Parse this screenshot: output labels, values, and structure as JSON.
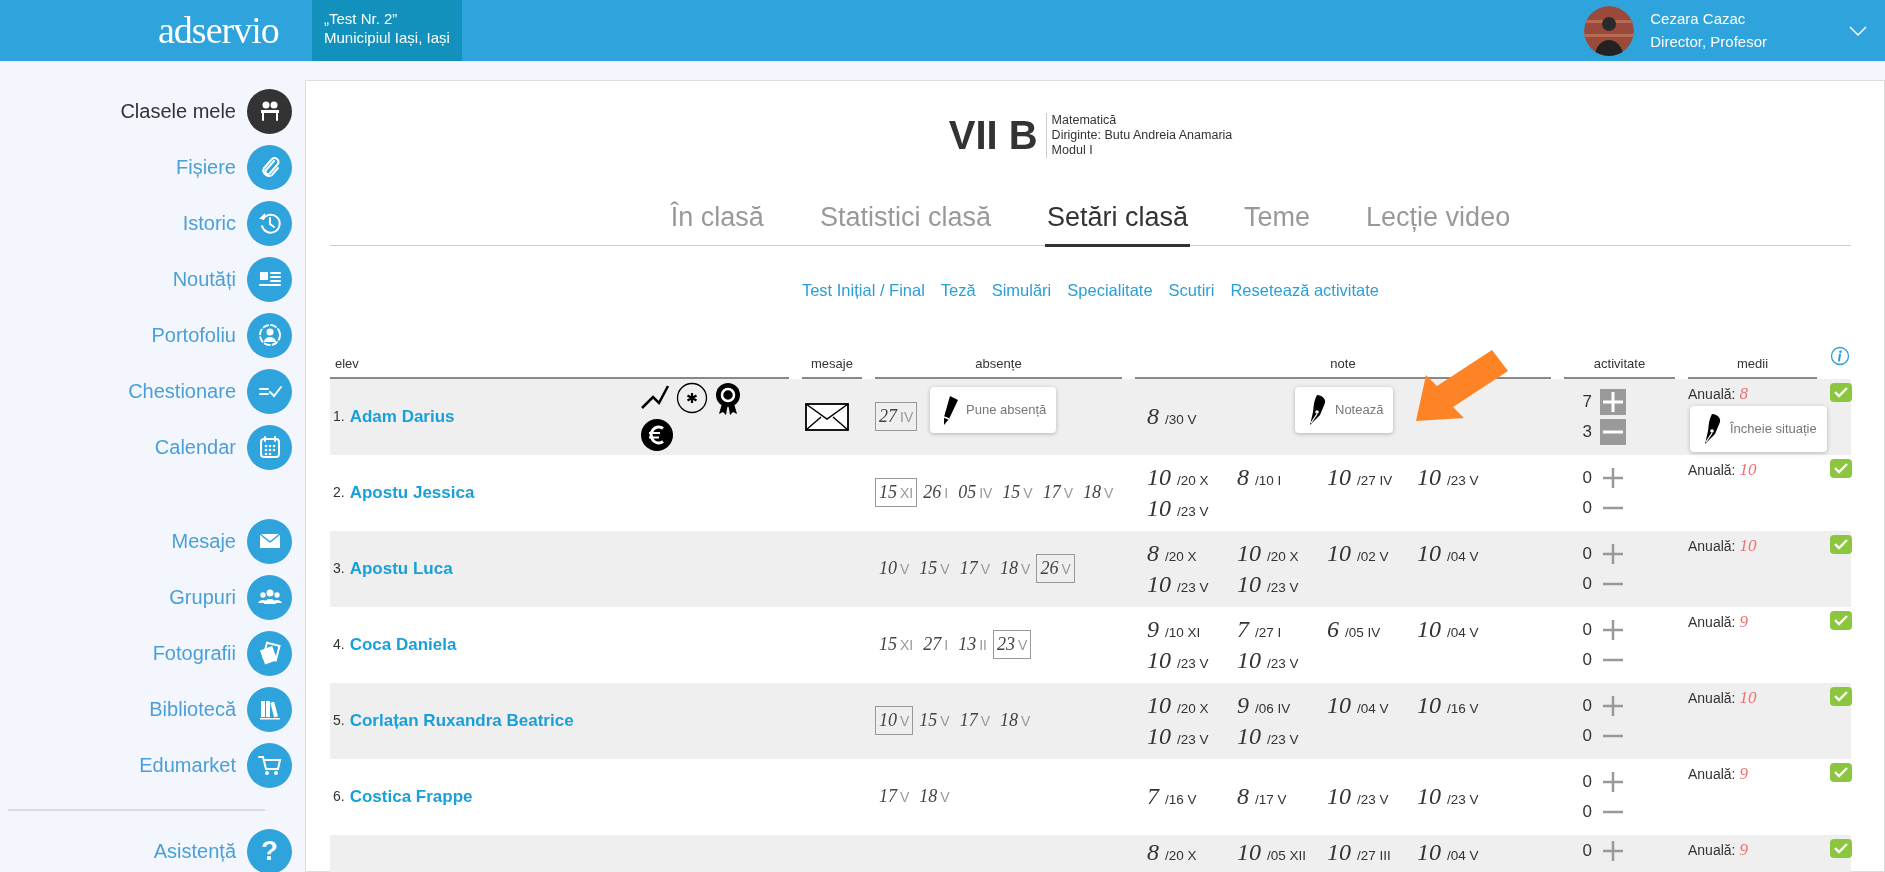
{
  "header": {
    "logo": "adservio",
    "school": {
      "name": "„Test Nr. 2”",
      "location": "Municipiul Iași, Iași"
    },
    "user": {
      "name": "Cezara Cazac",
      "role": "Director, Profesor"
    }
  },
  "sidebar": {
    "groups": [
      [
        {
          "label": "Clasele mele",
          "selected": true
        },
        {
          "label": "Fișiere",
          "selected": false
        },
        {
          "label": "Istoric",
          "selected": false
        },
        {
          "label": "Noutăți",
          "selected": false
        },
        {
          "label": "Portofoliu",
          "selected": false
        },
        {
          "label": "Chestionare",
          "selected": false
        },
        {
          "label": "Calendar",
          "selected": false
        }
      ],
      [
        {
          "label": "Mesaje",
          "selected": false
        },
        {
          "label": "Grupuri",
          "selected": false
        },
        {
          "label": "Fotografii",
          "selected": false
        },
        {
          "label": "Bibliotecă",
          "selected": false
        },
        {
          "label": "Edumarket",
          "selected": false
        }
      ]
    ],
    "help": {
      "label": "Asistență",
      "glyph": "?"
    }
  },
  "class_info": {
    "name": "VII B",
    "subject": "Matematică",
    "head_teacher": "Diriginte: Butu Andreia Anamaria",
    "module": "Modul I"
  },
  "tabs": [
    {
      "label": "În clasă",
      "selected": false
    },
    {
      "label": "Statistici clasă",
      "selected": false
    },
    {
      "label": "Setări clasă",
      "selected": true
    },
    {
      "label": "Teme",
      "selected": false
    },
    {
      "label": "Lecție video",
      "selected": false
    }
  ],
  "sub_links": [
    "Test Inițial / Final",
    "Teză",
    "Simulări",
    "Specialitate",
    "Scutiri",
    "Resetează activitate"
  ],
  "table": {
    "columns": [
      "elev",
      "mesaje",
      "absențe",
      "note",
      "activitate",
      "medii"
    ],
    "rows": [
      {
        "number": "1.",
        "name": "Adam Darius",
        "badges": true,
        "message": true,
        "absences": [
          {
            "day": "27",
            "month": "IV",
            "framed": true
          }
        ],
        "absence_action": "Pune absență",
        "grades": [
          {
            "grade": "8",
            "date": "/30 V"
          }
        ],
        "grade_action": "Notează",
        "activity": {
          "plus": "7",
          "minus": "3",
          "active": true
        },
        "average": {
          "label": "Anuală:",
          "value": "8"
        },
        "close_action": "Încheie situație"
      },
      {
        "number": "2.",
        "name": "Apostu Jessica",
        "message": false,
        "absences": [
          {
            "day": "15",
            "month": "XI",
            "framed": true
          },
          {
            "day": "26",
            "month": "I",
            "framed": false
          },
          {
            "day": "05",
            "month": "IV",
            "framed": false
          },
          {
            "day": "15",
            "month": "V",
            "framed": false
          },
          {
            "day": "17",
            "month": "V",
            "framed": false
          },
          {
            "day": "18",
            "month": "V",
            "framed": false
          }
        ],
        "grades": [
          {
            "grade": "10",
            "date": "/20 X"
          },
          {
            "grade": "8",
            "date": "/10 I"
          },
          {
            "grade": "10",
            "date": "/27 IV"
          },
          {
            "grade": "10",
            "date": "/23 V"
          },
          {
            "grade": "10",
            "date": "/23 V"
          }
        ],
        "activity": {
          "plus": "0",
          "minus": "0",
          "active": false
        },
        "average": {
          "label": "Anuală:",
          "value": "10"
        }
      },
      {
        "number": "3.",
        "name": "Apostu Luca",
        "message": false,
        "absences": [
          {
            "day": "10",
            "month": "V",
            "framed": false
          },
          {
            "day": "15",
            "month": "V",
            "framed": false
          },
          {
            "day": "17",
            "month": "V",
            "framed": false
          },
          {
            "day": "18",
            "month": "V",
            "framed": false
          },
          {
            "day": "26",
            "month": "V",
            "framed": true
          }
        ],
        "grades": [
          {
            "grade": "8",
            "date": "/20 X"
          },
          {
            "grade": "10",
            "date": "/20 X"
          },
          {
            "grade": "10",
            "date": "/02 V"
          },
          {
            "grade": "10",
            "date": "/04 V"
          },
          {
            "grade": "10",
            "date": "/23 V"
          },
          {
            "grade": "10",
            "date": "/23 V"
          }
        ],
        "activity": {
          "plus": "0",
          "minus": "0",
          "active": false
        },
        "average": {
          "label": "Anuală:",
          "value": "10"
        }
      },
      {
        "number": "4.",
        "name": "Coca Daniela",
        "message": false,
        "absences": [
          {
            "day": "15",
            "month": "XI",
            "framed": false
          },
          {
            "day": "27",
            "month": "I",
            "framed": false
          },
          {
            "day": "13",
            "month": "II",
            "framed": false
          },
          {
            "day": "23",
            "month": "V",
            "framed": true
          }
        ],
        "grades": [
          {
            "grade": "9",
            "date": "/10 XI"
          },
          {
            "grade": "7",
            "date": "/27 I"
          },
          {
            "grade": "6",
            "date": "/05 IV"
          },
          {
            "grade": "10",
            "date": "/04 V"
          },
          {
            "grade": "10",
            "date": "/23 V"
          },
          {
            "grade": "10",
            "date": "/23 V"
          }
        ],
        "activity": {
          "plus": "0",
          "minus": "0",
          "active": false
        },
        "average": {
          "label": "Anuală:",
          "value": "9"
        }
      },
      {
        "number": "5.",
        "name": "Corlațan Ruxandra Beatrice",
        "message": false,
        "absences": [
          {
            "day": "10",
            "month": "V",
            "framed": true
          },
          {
            "day": "15",
            "month": "V",
            "framed": false
          },
          {
            "day": "17",
            "month": "V",
            "framed": false
          },
          {
            "day": "18",
            "month": "V",
            "framed": false
          }
        ],
        "grades": [
          {
            "grade": "10",
            "date": "/20 X"
          },
          {
            "grade": "9",
            "date": "/06 IV"
          },
          {
            "grade": "10",
            "date": "/04 V"
          },
          {
            "grade": "10",
            "date": "/16 V"
          },
          {
            "grade": "10",
            "date": "/23 V"
          },
          {
            "grade": "10",
            "date": "/23 V"
          }
        ],
        "activity": {
          "plus": "0",
          "minus": "0",
          "active": false
        },
        "average": {
          "label": "Anuală:",
          "value": "10"
        }
      },
      {
        "number": "6.",
        "name": "Costica Frappe",
        "message": false,
        "absences": [
          {
            "day": "17",
            "month": "V",
            "framed": false
          },
          {
            "day": "18",
            "month": "V",
            "framed": false
          }
        ],
        "grades": [
          {
            "grade": "7",
            "date": "/16 V"
          },
          {
            "grade": "8",
            "date": "/17 V"
          },
          {
            "grade": "10",
            "date": "/23 V"
          },
          {
            "grade": "10",
            "date": "/23 V"
          }
        ],
        "activity": {
          "plus": "0",
          "minus": "0",
          "active": false
        },
        "average": {
          "label": "Anuală:",
          "value": "9"
        }
      },
      {
        "message": false,
        "absences": [],
        "grades": [
          {
            "grade": "8",
            "date": "/20 X"
          },
          {
            "grade": "10",
            "date": "/05 XII"
          },
          {
            "grade": "10",
            "date": "/27 III"
          },
          {
            "grade": "10",
            "date": "/04 V"
          }
        ],
        "activity": {
          "plus": "0",
          "active": false
        },
        "average": {
          "label": "Anuală:",
          "value": "9"
        }
      }
    ]
  }
}
